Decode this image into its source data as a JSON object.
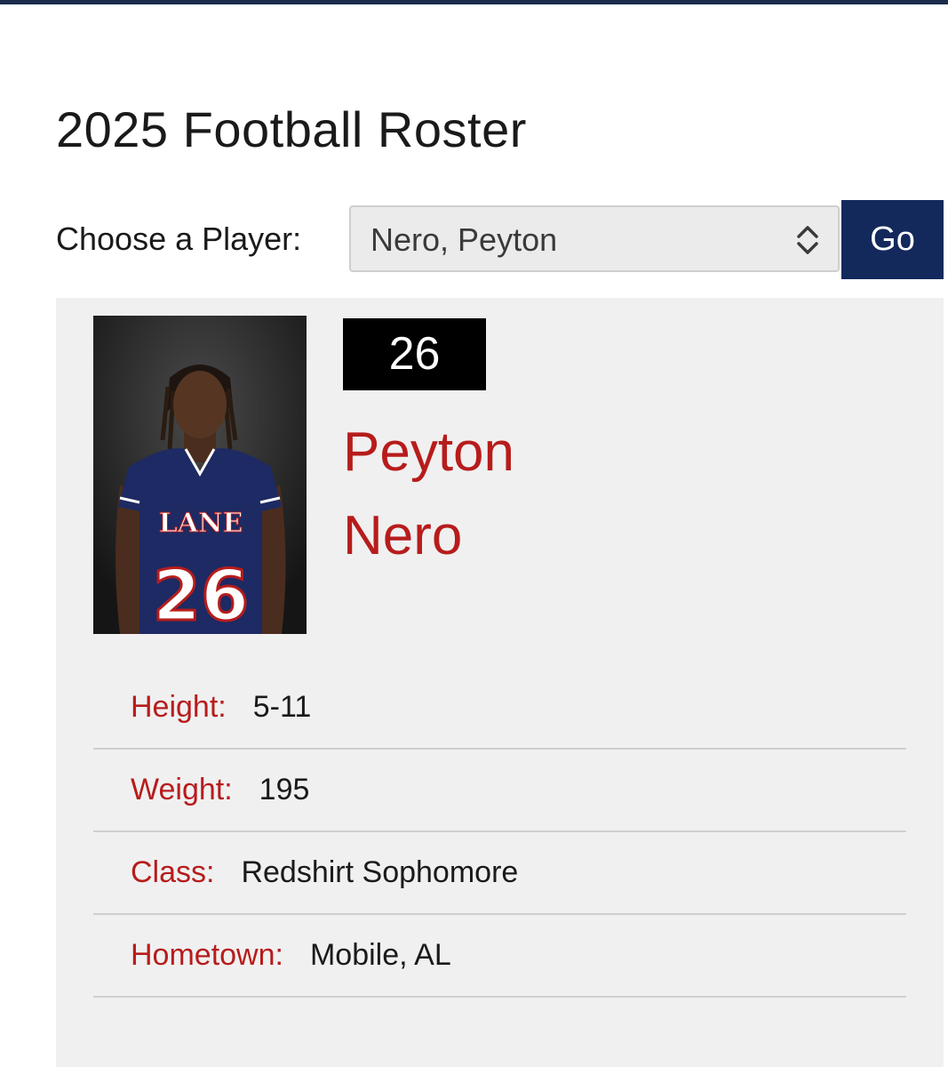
{
  "page": {
    "title": "2025 Football Roster"
  },
  "chooser": {
    "label": "Choose a Player:",
    "selected": "Nero, Peyton",
    "go_label": "Go"
  },
  "player": {
    "number": "26",
    "first_name": "Peyton",
    "last_name": "Nero",
    "photo_icon": "player-headshot",
    "photo_jersey_text": "LANE",
    "photo_jersey_number": "26",
    "details": [
      {
        "label": "Height:",
        "value": "5-11"
      },
      {
        "label": "Weight:",
        "value": "195"
      },
      {
        "label": "Class:",
        "value": "Redshirt Sophomore"
      },
      {
        "label": "Hometown:",
        "value": "Mobile, AL"
      }
    ]
  },
  "colors": {
    "accent_red": "#b71c1c",
    "navy": "#13295c",
    "card_bg": "#f0f0f0"
  }
}
